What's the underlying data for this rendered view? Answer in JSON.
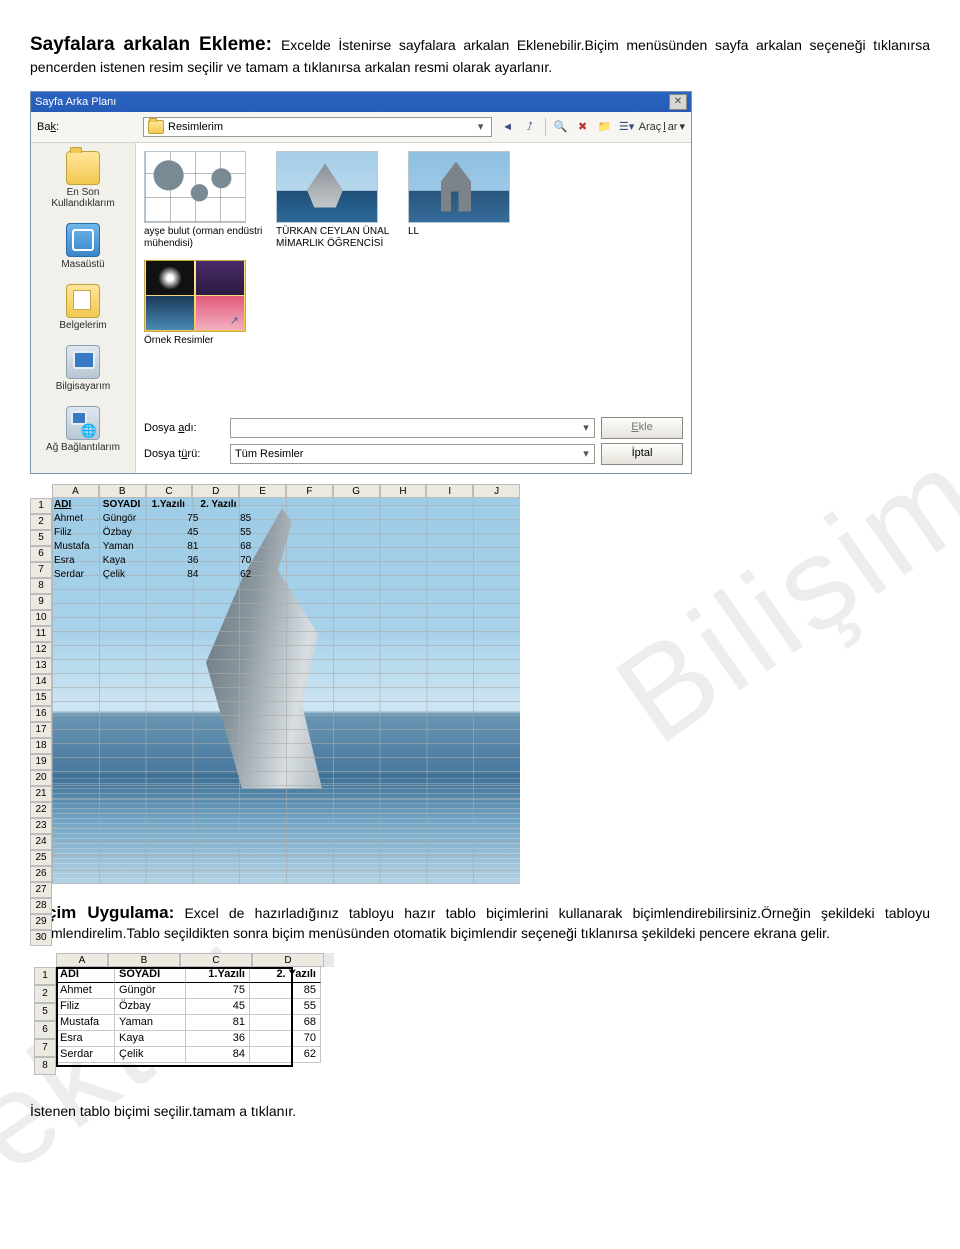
{
  "intro": {
    "heading": "Sayfalara arkalan Ekleme",
    "colon": ": ",
    "body": "Excelde İstenirse sayfalara arkalan Eklenebilir.Biçim menüsünden sayfa arkalan seçeneği tıklanırsa pencerden istenen resim seçilir ve tamam a tıklanırsa arkalan resmi olarak ayarlanır."
  },
  "dialog": {
    "title": "Sayfa Arka Planı",
    "look_label_pre": "Ba",
    "look_label_u": "k",
    "look_label_post": ":",
    "look_value": "Resimlerim",
    "tools_label_pre": "Araç",
    "tools_label_u": "l",
    "tools_label_post": "ar",
    "places": [
      {
        "name": "En Son Kullandıklarım",
        "cls": "folder"
      },
      {
        "name": "Masaüstü",
        "cls": "desk"
      },
      {
        "name": "Belgelerim",
        "cls": "docs"
      },
      {
        "name": "Bilgisayarım",
        "cls": "pc"
      },
      {
        "name": "Ağ Bağlantılarım",
        "cls": "net"
      }
    ],
    "files_top": [
      {
        "cap": "ayşe bulut (orman endüstri mühendisi)",
        "cls": "grid"
      },
      {
        "cap": "TÜRKAN CEYLAN ÜNAL MİMARLIK ÖĞRENCİSİ",
        "cls": "sky"
      },
      {
        "cap": "LL",
        "cls": "ll"
      }
    ],
    "files_bottom": [
      {
        "cap": "Örnek Resimler",
        "cls": "samples",
        "folder": true
      }
    ],
    "fname_label_pre": "Dosya ",
    "fname_label_u": "a",
    "fname_label_post": "dı:",
    "fname_value": "",
    "ftype_label_pre": "Dosya t",
    "ftype_label_u": "ü",
    "ftype_label_post": "rü:",
    "ftype_value": "Tüm Resimler",
    "btn_insert_pre": "",
    "btn_insert_u": "E",
    "btn_insert_post": "kle",
    "btn_cancel": "İptal"
  },
  "sheet": {
    "columns": [
      "A",
      "B",
      "C",
      "D",
      "E",
      "F",
      "G",
      "H",
      "I",
      "J"
    ],
    "row_numbers": [
      "1",
      "2",
      "5",
      "6",
      "7",
      "8",
      "9",
      "10",
      "11",
      "12",
      "13",
      "14",
      "15",
      "16",
      "17",
      "18",
      "19",
      "20",
      "21",
      "22",
      "23",
      "24",
      "25",
      "26",
      "27",
      "28",
      "29",
      "30"
    ],
    "rows": [
      [
        "ADI",
        "SOYADI",
        "1.Yazılı",
        "2. Yazılı"
      ],
      [
        "Ahmet",
        "Güngör",
        "75",
        "85"
      ],
      [
        "Filiz",
        "Özbay",
        "45",
        "55"
      ],
      [
        "Mustafa",
        "Yaman",
        "81",
        "68"
      ],
      [
        "Esra",
        "Kaya",
        "36",
        "70"
      ],
      [
        "Serdar",
        "Çelik",
        "84",
        "62"
      ]
    ]
  },
  "mid": {
    "heading": "Biçim Uygulama:",
    "body": " Excel de hazırladığınız tabloyu hazır tablo biçimlerini kullanarak biçimlendirebilirsiniz.Örneğin şekildeki tabloyu biçimlendirelim.Tablo seçildikten sonra biçim menüsünden otomatik biçimlendir seçeneği tıklanırsa şekildeki pencere ekrana gelir."
  },
  "small": {
    "columns": [
      "A",
      "B",
      "C",
      "D"
    ],
    "row_numbers": [
      "1",
      "2",
      "5",
      "6",
      "7",
      "8"
    ],
    "rows": [
      [
        "ADI",
        "SOYADI",
        "1.Yazılı",
        "2. Yazılı"
      ],
      [
        "Ahmet",
        "Güngör",
        "75",
        "85"
      ],
      [
        "Filiz",
        "Özbay",
        "45",
        "55"
      ],
      [
        "Mustafa",
        "Yaman",
        "81",
        "68"
      ],
      [
        "Esra",
        "Kaya",
        "36",
        "70"
      ],
      [
        "Serdar",
        "Çelik",
        "84",
        "62"
      ]
    ]
  },
  "footer": "İstenen tablo biçimi seçilir.tamam a tıklanır.",
  "watermark": "Bilişim",
  "watermark2": "Vektör",
  "chart_data": {
    "type": "table",
    "columns": [
      "ADI",
      "SOYADI",
      "1.Yazılı",
      "2. Yazılı"
    ],
    "rows": [
      [
        "Ahmet",
        "Güngör",
        75,
        85
      ],
      [
        "Filiz",
        "Özbay",
        45,
        55
      ],
      [
        "Mustafa",
        "Yaman",
        81,
        68
      ],
      [
        "Esra",
        "Kaya",
        36,
        70
      ],
      [
        "Serdar",
        "Çelik",
        84,
        62
      ]
    ]
  }
}
